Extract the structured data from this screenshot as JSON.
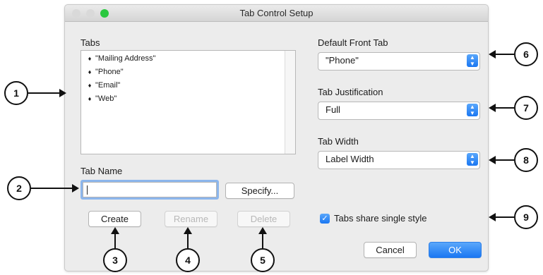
{
  "window": {
    "title": "Tab Control Setup",
    "traffic_lights": {
      "close": "#d9d9d9",
      "minimize": "#d9d9d9",
      "zoom": "#2bc840"
    }
  },
  "tabs_section": {
    "label": "Tabs",
    "items": [
      "\"Mailing Address\"",
      "\"Phone\"",
      "\"Email\"",
      "\"Web\""
    ],
    "bullet": "♦"
  },
  "tab_name": {
    "label": "Tab Name",
    "value": "",
    "specify_label": "Specify..."
  },
  "buttons": {
    "create": "Create",
    "rename": "Rename",
    "delete": "Delete",
    "cancel": "Cancel",
    "ok": "OK"
  },
  "default_front_tab": {
    "label": "Default Front Tab",
    "value": "\"Phone\""
  },
  "tab_justification": {
    "label": "Tab Justification",
    "value": "Full"
  },
  "tab_width": {
    "label": "Tab Width",
    "value": "Label Width"
  },
  "share_style": {
    "label": "Tabs share single style",
    "checked": true
  },
  "callouts": [
    "1",
    "2",
    "3",
    "4",
    "5",
    "6",
    "7",
    "8",
    "9"
  ],
  "colors": {
    "accent": "#1a77f2",
    "focus_ring": "#8cb6ec"
  }
}
